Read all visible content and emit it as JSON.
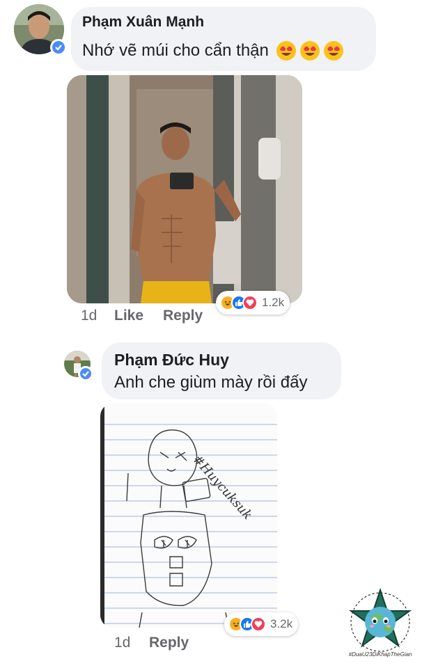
{
  "comments": [
    {
      "author": "Phạm Xuân Mạnh",
      "text": "Nhớ vẽ múi cho cẩn thận",
      "emoji": [
        "heart-eyes",
        "heart-eyes",
        "heart-eyes"
      ],
      "reactions": [
        "haha",
        "like",
        "love"
      ],
      "reaction_count": "1.2k",
      "time": "1d",
      "like_label": "Like",
      "reply_label": "Reply"
    },
    {
      "author": "Phạm Đức Huy",
      "text": "Anh che giùm mày rồi đấy",
      "reactions": [
        "haha",
        "like",
        "love"
      ],
      "reaction_count": "3.2k",
      "time": "1d",
      "reply_label": "Reply",
      "sketch_caption": "#Huycuksuk"
    }
  ],
  "watermark": {
    "caption": "#DuaU23DiKhapTheGian"
  },
  "colors": {
    "bubble": "#f0f2f5",
    "verified": "#4a8cf7",
    "like": "#1877f2",
    "love": "#f33e58",
    "haha": "#f7b125",
    "muted_text": "#65676b"
  }
}
